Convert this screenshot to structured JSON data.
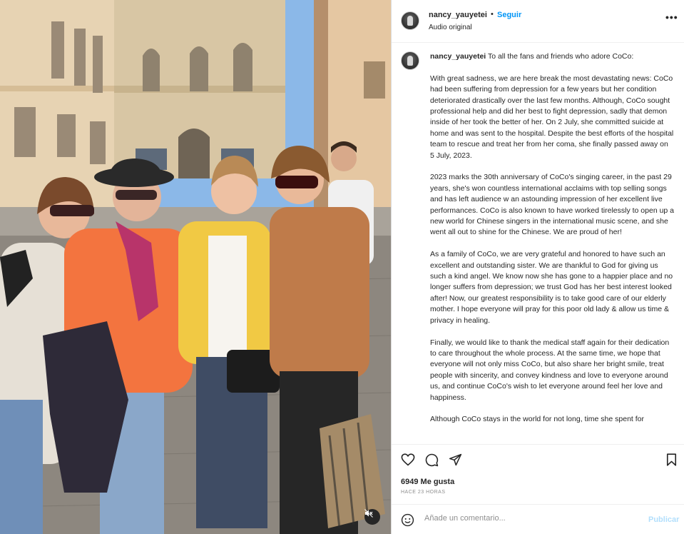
{
  "post": {
    "username": "nancy_yauyetei",
    "separator": "•",
    "follow_label": "Seguir",
    "audio_label": "Audio original",
    "more_label": "•••"
  },
  "caption": {
    "username": "nancy_yauyetei",
    "greeting": "To all the fans and friends who adore CoCo:",
    "paragraphs": [
      "With great sadness, we are here break the most devastating news: CoCo had been suffering from depression for a few years but her condition deteriorated drastically over the last few months. Although, CoCo sought professional help and did her best to fight depression, sadly that demon inside of her took the better of her. On 2 July, she committed suicide at home and was sent to the hospital. Despite the best efforts of the hospital team to rescue and treat her from her coma, she finally passed away on 5 July, 2023.",
      "2023 marks the 30th anniversary of CoCo's singing career, in the past 29 years, she's won countless international acclaims with top selling songs and has left audience w an astounding impression of her excellent live performances. CoCo is also known to have worked tirelessly to open up a new world for Chinese singers in the international music scene, and she went all out to shine for the Chinese. We are proud of her!",
      "As a family of CoCo, we are very grateful and honored to have such an excellent and outstanding sister. We are thankful to God for giving us such a kind angel. We know now she has gone to a happier place and no longer suffers from depression; we trust God has her best interest looked after! Now, our greatest responsibility is to take good care of our elderly mother. I hope everyone will pray for this poor old lady & allow us time & privacy in healing.",
      "Finally, we would like to thank the medical staff again for their dedication to care throughout the whole process. At the same time, we hope that everyone will not only miss CoCo, but also share her bright smile, treat people with sincerity, and convey kindness and love to everyone around us, and continue CoCo's wish to let everyone around feel her love and happiness.",
      "Although CoCo stays in the world for not long, time she spent for"
    ]
  },
  "actions": {
    "like_icon": "heart-icon",
    "comment_icon": "comment-icon",
    "share_icon": "share-icon",
    "save_icon": "bookmark-icon",
    "likes_text": "6949 Me gusta",
    "timestamp": "HACE 23 HORAS"
  },
  "comment": {
    "emoji_icon": "emoji-icon",
    "placeholder": "Añade un comentario...",
    "publish_label": "Publicar"
  },
  "photo": {
    "mute_icon": "muted-speaker-icon"
  },
  "colors": {
    "link": "#0095f6",
    "publish_disabled": "#b2dffc",
    "text": "#262626",
    "secondary": "#8e8e8e"
  }
}
